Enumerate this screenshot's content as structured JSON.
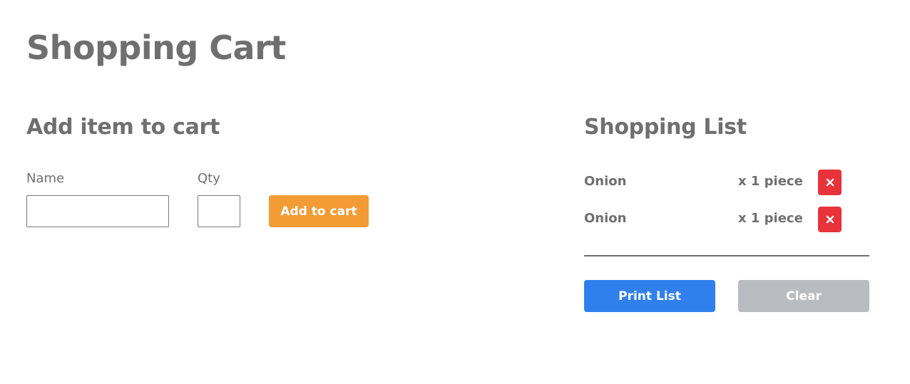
{
  "header": {
    "title": "Shopping Cart"
  },
  "add_item": {
    "title": "Add item to cart",
    "name_label": "Name",
    "name_value": "",
    "qty_label": "Qty",
    "qty_value": "",
    "add_button_label": "Add to cart"
  },
  "shopping_list": {
    "title": "Shopping List",
    "items": [
      {
        "name": "Onion",
        "quantity": "x 1 piece",
        "remove_icon": "close-icon"
      },
      {
        "name": "Onion",
        "quantity": "x 1 piece",
        "remove_icon": "close-icon"
      }
    ],
    "print_button_label": "Print List",
    "clear_button_label": "Clear"
  },
  "colors": {
    "text": "#6f6f6f",
    "add_button": "#f39b35",
    "print_button": "#2f80ed",
    "clear_button": "#b9bcc1",
    "remove_button": "#e8333a"
  }
}
